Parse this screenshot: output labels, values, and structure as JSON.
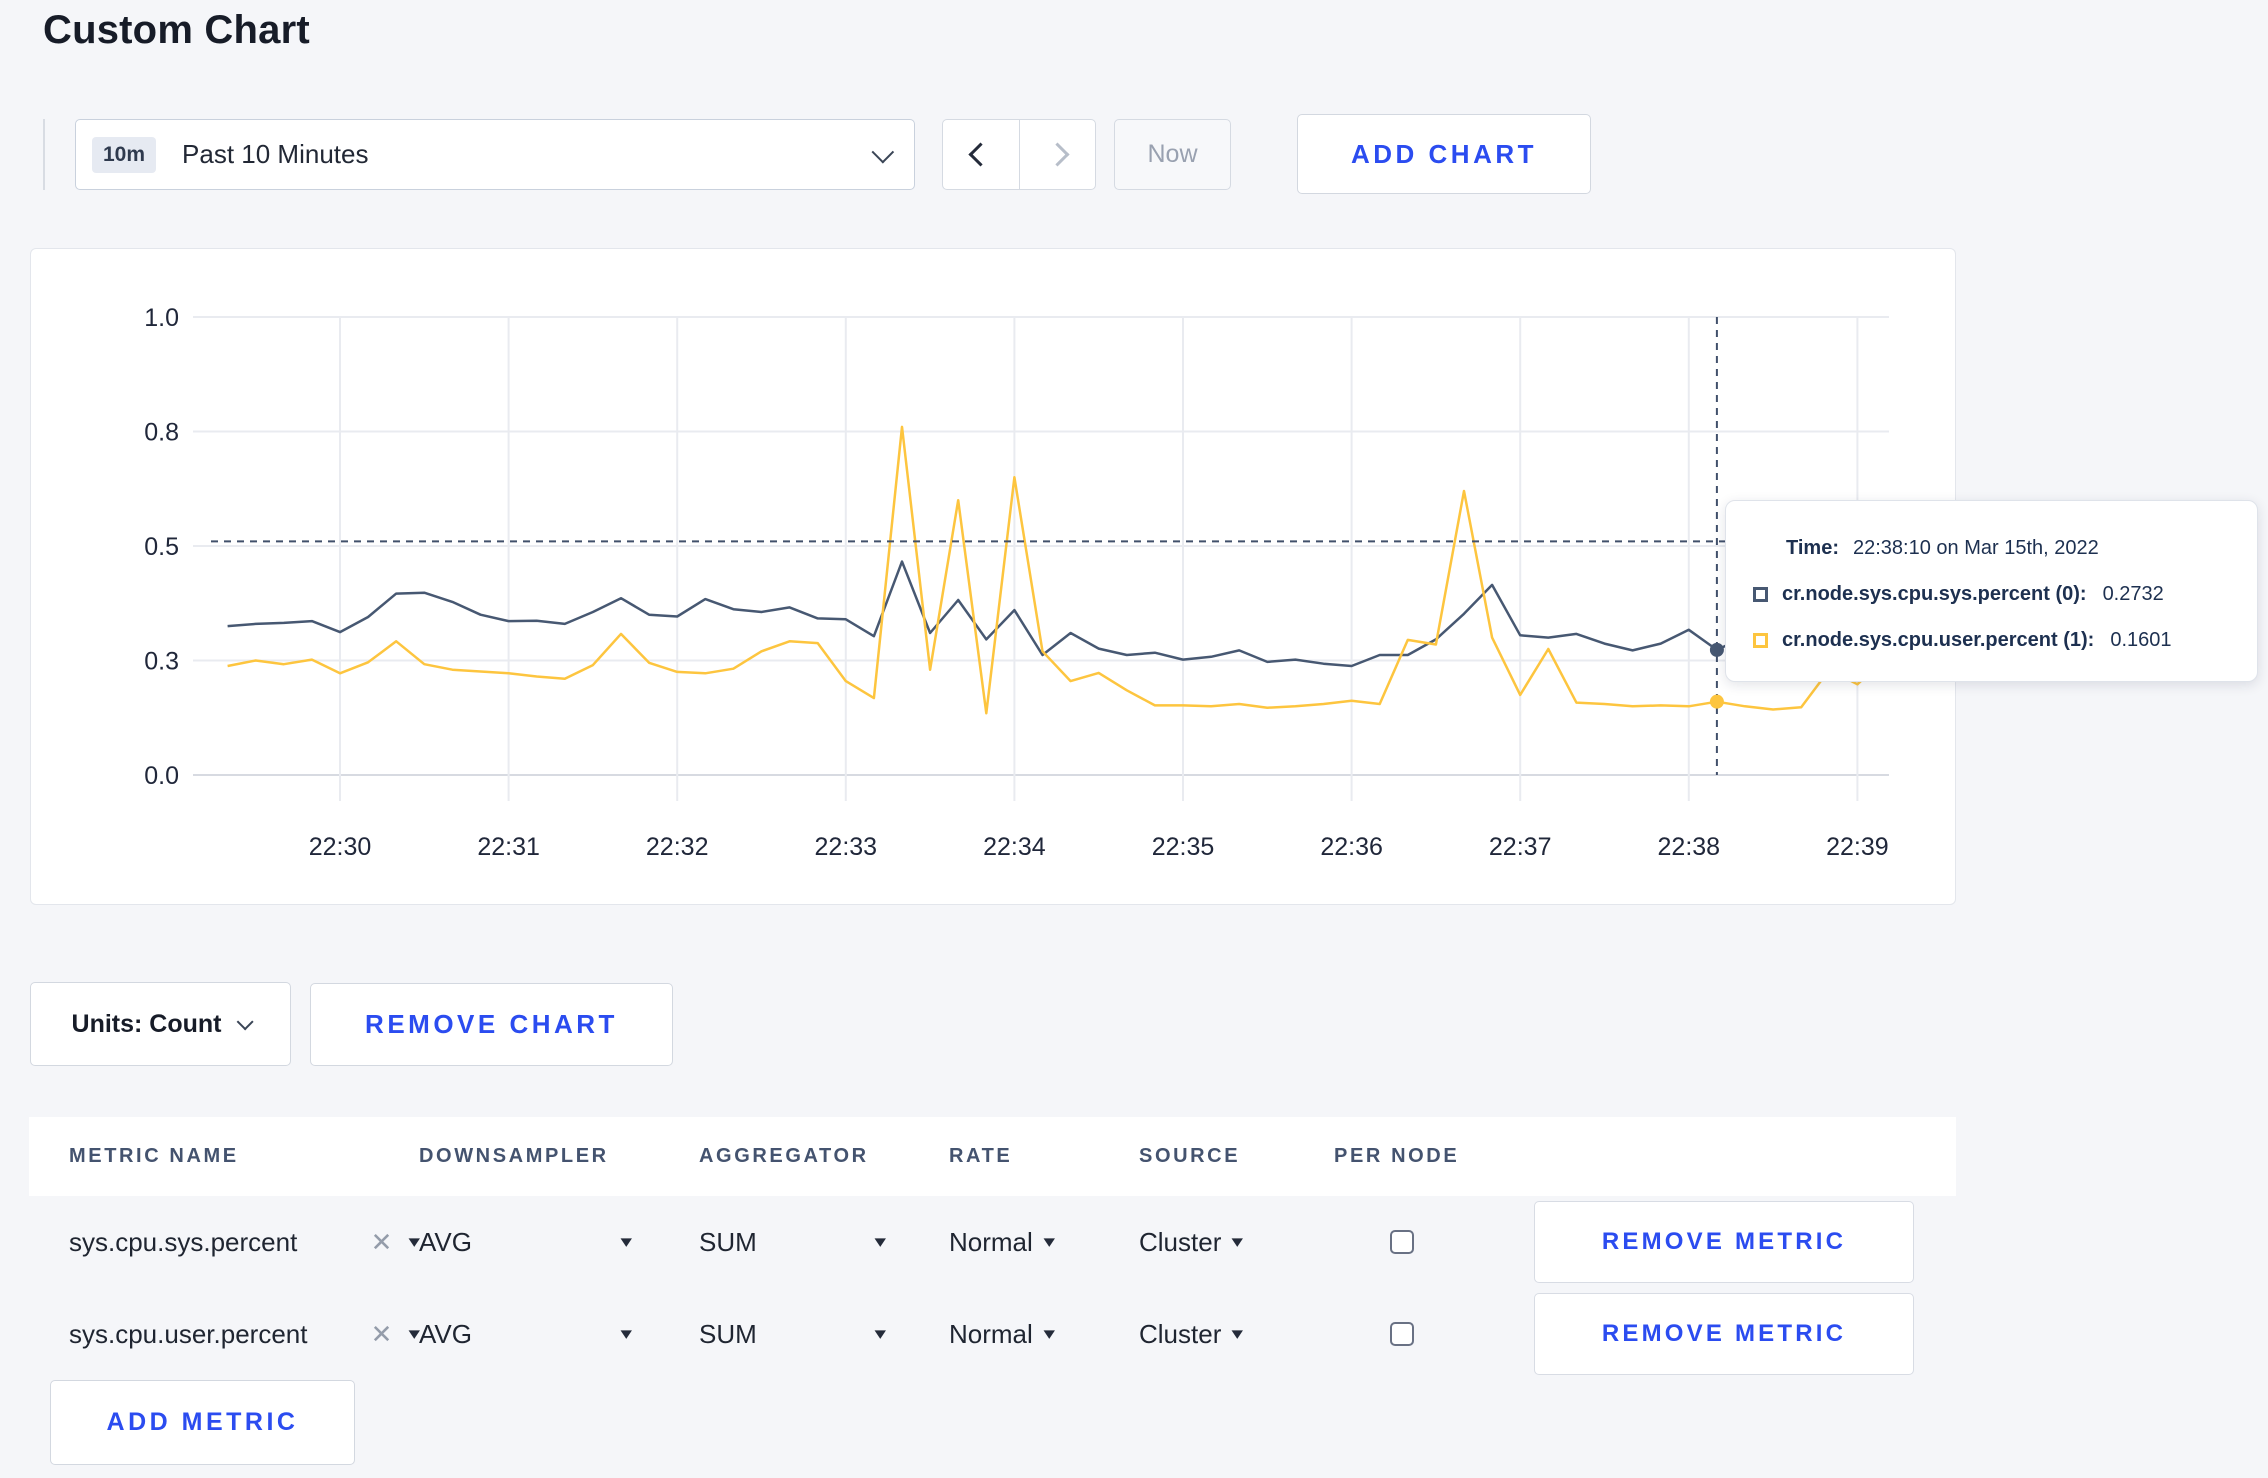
{
  "page": {
    "title": "Custom Chart"
  },
  "toolbar": {
    "time_range": {
      "badge": "10m",
      "label": "Past 10 Minutes"
    },
    "now_label": "Now",
    "add_chart_label": "ADD CHART"
  },
  "chart_data": {
    "type": "line",
    "x_start_time": "22:29:20",
    "x_step_seconds": 10,
    "x_tick_labels": [
      "22:30",
      "22:31",
      "22:32",
      "22:33",
      "22:34",
      "22:35",
      "22:36",
      "22:37",
      "22:38",
      "22:39"
    ],
    "y_tick_values": [
      0,
      0.25,
      0.5,
      0.75,
      1.0
    ],
    "y_tick_labels": [
      "0.0",
      "0.3",
      "0.5",
      "0.8",
      "1.0"
    ],
    "ylim": [
      0,
      1.0
    ],
    "grid": true,
    "series": [
      {
        "name": "cr.node.sys.cpu.sys.percent (0)",
        "color": "#475872",
        "values": [
          0.325,
          0.33,
          0.332,
          0.336,
          0.312,
          0.345,
          0.396,
          0.398,
          0.378,
          0.35,
          0.336,
          0.337,
          0.33,
          0.356,
          0.386,
          0.35,
          0.346,
          0.384,
          0.362,
          0.356,
          0.366,
          0.342,
          0.34,
          0.303,
          0.466,
          0.31,
          0.382,
          0.296,
          0.36,
          0.262,
          0.31,
          0.276,
          0.262,
          0.267,
          0.252,
          0.258,
          0.272,
          0.247,
          0.252,
          0.243,
          0.238,
          0.262,
          0.262,
          0.296,
          0.352,
          0.415,
          0.305,
          0.3,
          0.308,
          0.287,
          0.272,
          0.287,
          0.317,
          0.2732,
          0.302,
          0.29,
          0.298,
          0.295,
          0.3,
          0.308,
          0.302
        ]
      },
      {
        "name": "cr.node.sys.cpu.user.percent (1)",
        "color": "#fdc53f",
        "values": [
          0.238,
          0.25,
          0.242,
          0.252,
          0.222,
          0.246,
          0.292,
          0.242,
          0.23,
          0.226,
          0.222,
          0.215,
          0.21,
          0.24,
          0.308,
          0.245,
          0.225,
          0.222,
          0.232,
          0.27,
          0.292,
          0.288,
          0.205,
          0.168,
          0.76,
          0.23,
          0.6,
          0.135,
          0.65,
          0.27,
          0.205,
          0.223,
          0.185,
          0.152,
          0.152,
          0.15,
          0.155,
          0.147,
          0.15,
          0.155,
          0.162,
          0.155,
          0.295,
          0.285,
          0.62,
          0.3,
          0.175,
          0.275,
          0.158,
          0.155,
          0.15,
          0.152,
          0.15,
          0.1601,
          0.15,
          0.143,
          0.148,
          0.23,
          0.198,
          0.255,
          0.25
        ]
      }
    ],
    "hover": {
      "time_label": "22:38:10",
      "x_offset_seconds": 530,
      "hline_value": 0.51,
      "point_values": [
        0.2732,
        0.1601
      ]
    }
  },
  "tooltip": {
    "time_label": "Time:",
    "time_value": "22:38:10 on Mar 15th, 2022",
    "rows": [
      {
        "label": "cr.node.sys.cpu.sys.percent (0):",
        "value": "0.2732"
      },
      {
        "label": "cr.node.sys.cpu.user.percent (1):",
        "value": "0.1601"
      }
    ]
  },
  "chart_controls": {
    "units_label": "Units: Count",
    "remove_chart_label": "REMOVE CHART"
  },
  "metrics_table": {
    "headers": [
      "METRIC NAME",
      "DOWNSAMPLER",
      "AGGREGATOR",
      "RATE",
      "SOURCE",
      "PER NODE"
    ],
    "rows": [
      {
        "metric_name": "sys.cpu.sys.percent",
        "downsampler": "AVG",
        "aggregator": "SUM",
        "rate": "Normal",
        "source": "Cluster",
        "per_node_checked": false,
        "remove_label": "REMOVE METRIC"
      },
      {
        "metric_name": "sys.cpu.user.percent",
        "downsampler": "AVG",
        "aggregator": "SUM",
        "rate": "Normal",
        "source": "Cluster",
        "per_node_checked": false,
        "remove_label": "REMOVE METRIC"
      }
    ],
    "add_metric_label": "ADD METRIC"
  },
  "colors": {
    "accent_blue": "#2b4cf0",
    "series_sys": "#475872",
    "series_user": "#fdc53f",
    "hover_dash": "#41506b",
    "grid": "#e9ebf0",
    "grid_zero": "#d7dae1"
  }
}
